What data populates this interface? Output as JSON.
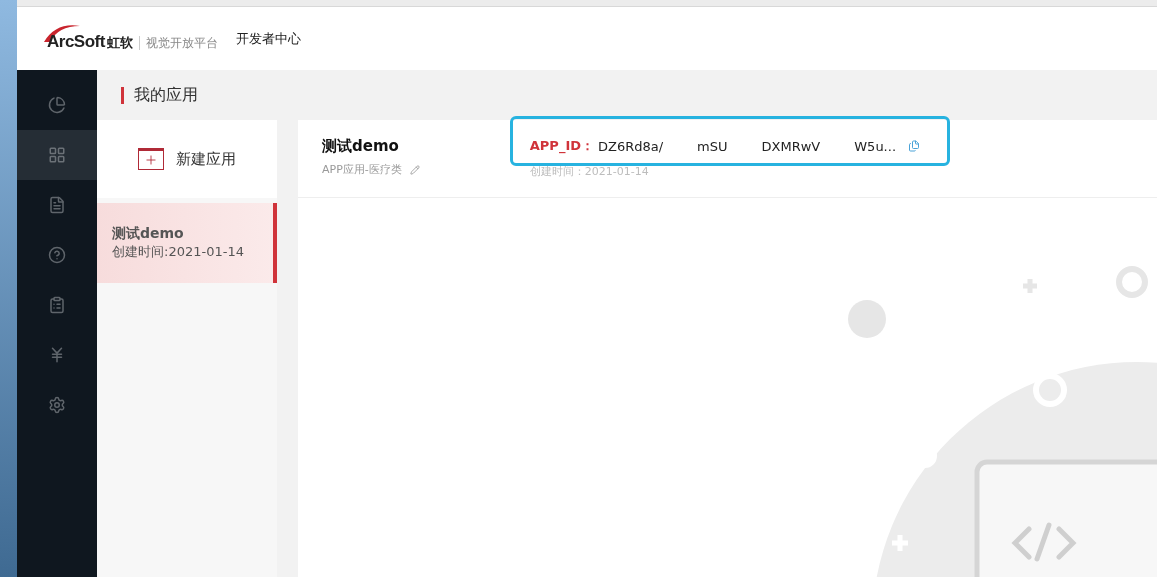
{
  "header": {
    "brand": "ArcSoft",
    "brand_cn": "虹软",
    "platform": "视觉开放平台",
    "nav_title": "开发者中心"
  },
  "sidebar": {
    "items": [
      {
        "selected": false
      },
      {
        "selected": true
      },
      {
        "selected": false
      },
      {
        "selected": false
      },
      {
        "selected": false
      },
      {
        "selected": false
      },
      {
        "selected": false
      }
    ]
  },
  "page_title": "我的应用",
  "app_list": {
    "new_button": "新建应用",
    "items": [
      {
        "name": "测试demo",
        "created": "创建时间:2021-01-14",
        "selected": true
      }
    ]
  },
  "app_detail": {
    "name": "测试demo",
    "category": "APP应用-医疗类",
    "app_id_label": "APP_ID：",
    "app_id_parts": [
      "DZ6Rd8a/",
      "mSU",
      "DXMRwV",
      "W5u..."
    ],
    "created": "创建时间：2021-01-14"
  }
}
